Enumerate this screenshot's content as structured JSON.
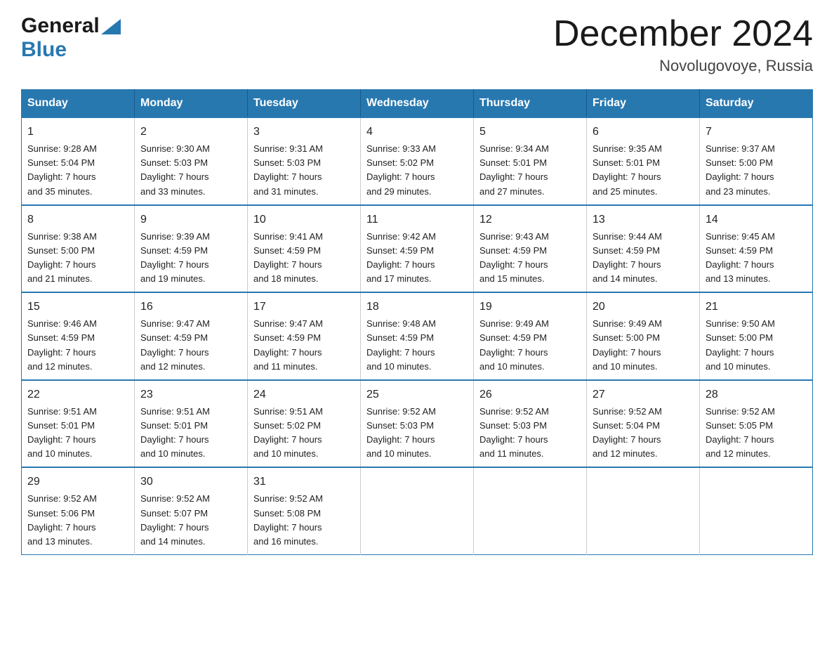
{
  "header": {
    "logo_general": "General",
    "logo_blue": "Blue",
    "month_title": "December 2024",
    "location": "Novolugovoye, Russia"
  },
  "days_of_week": [
    "Sunday",
    "Monday",
    "Tuesday",
    "Wednesday",
    "Thursday",
    "Friday",
    "Saturday"
  ],
  "weeks": [
    [
      {
        "day": "1",
        "info": "Sunrise: 9:28 AM\nSunset: 5:04 PM\nDaylight: 7 hours\nand 35 minutes."
      },
      {
        "day": "2",
        "info": "Sunrise: 9:30 AM\nSunset: 5:03 PM\nDaylight: 7 hours\nand 33 minutes."
      },
      {
        "day": "3",
        "info": "Sunrise: 9:31 AM\nSunset: 5:03 PM\nDaylight: 7 hours\nand 31 minutes."
      },
      {
        "day": "4",
        "info": "Sunrise: 9:33 AM\nSunset: 5:02 PM\nDaylight: 7 hours\nand 29 minutes."
      },
      {
        "day": "5",
        "info": "Sunrise: 9:34 AM\nSunset: 5:01 PM\nDaylight: 7 hours\nand 27 minutes."
      },
      {
        "day": "6",
        "info": "Sunrise: 9:35 AM\nSunset: 5:01 PM\nDaylight: 7 hours\nand 25 minutes."
      },
      {
        "day": "7",
        "info": "Sunrise: 9:37 AM\nSunset: 5:00 PM\nDaylight: 7 hours\nand 23 minutes."
      }
    ],
    [
      {
        "day": "8",
        "info": "Sunrise: 9:38 AM\nSunset: 5:00 PM\nDaylight: 7 hours\nand 21 minutes."
      },
      {
        "day": "9",
        "info": "Sunrise: 9:39 AM\nSunset: 4:59 PM\nDaylight: 7 hours\nand 19 minutes."
      },
      {
        "day": "10",
        "info": "Sunrise: 9:41 AM\nSunset: 4:59 PM\nDaylight: 7 hours\nand 18 minutes."
      },
      {
        "day": "11",
        "info": "Sunrise: 9:42 AM\nSunset: 4:59 PM\nDaylight: 7 hours\nand 17 minutes."
      },
      {
        "day": "12",
        "info": "Sunrise: 9:43 AM\nSunset: 4:59 PM\nDaylight: 7 hours\nand 15 minutes."
      },
      {
        "day": "13",
        "info": "Sunrise: 9:44 AM\nSunset: 4:59 PM\nDaylight: 7 hours\nand 14 minutes."
      },
      {
        "day": "14",
        "info": "Sunrise: 9:45 AM\nSunset: 4:59 PM\nDaylight: 7 hours\nand 13 minutes."
      }
    ],
    [
      {
        "day": "15",
        "info": "Sunrise: 9:46 AM\nSunset: 4:59 PM\nDaylight: 7 hours\nand 12 minutes."
      },
      {
        "day": "16",
        "info": "Sunrise: 9:47 AM\nSunset: 4:59 PM\nDaylight: 7 hours\nand 12 minutes."
      },
      {
        "day": "17",
        "info": "Sunrise: 9:47 AM\nSunset: 4:59 PM\nDaylight: 7 hours\nand 11 minutes."
      },
      {
        "day": "18",
        "info": "Sunrise: 9:48 AM\nSunset: 4:59 PM\nDaylight: 7 hours\nand 10 minutes."
      },
      {
        "day": "19",
        "info": "Sunrise: 9:49 AM\nSunset: 4:59 PM\nDaylight: 7 hours\nand 10 minutes."
      },
      {
        "day": "20",
        "info": "Sunrise: 9:49 AM\nSunset: 5:00 PM\nDaylight: 7 hours\nand 10 minutes."
      },
      {
        "day": "21",
        "info": "Sunrise: 9:50 AM\nSunset: 5:00 PM\nDaylight: 7 hours\nand 10 minutes."
      }
    ],
    [
      {
        "day": "22",
        "info": "Sunrise: 9:51 AM\nSunset: 5:01 PM\nDaylight: 7 hours\nand 10 minutes."
      },
      {
        "day": "23",
        "info": "Sunrise: 9:51 AM\nSunset: 5:01 PM\nDaylight: 7 hours\nand 10 minutes."
      },
      {
        "day": "24",
        "info": "Sunrise: 9:51 AM\nSunset: 5:02 PM\nDaylight: 7 hours\nand 10 minutes."
      },
      {
        "day": "25",
        "info": "Sunrise: 9:52 AM\nSunset: 5:03 PM\nDaylight: 7 hours\nand 10 minutes."
      },
      {
        "day": "26",
        "info": "Sunrise: 9:52 AM\nSunset: 5:03 PM\nDaylight: 7 hours\nand 11 minutes."
      },
      {
        "day": "27",
        "info": "Sunrise: 9:52 AM\nSunset: 5:04 PM\nDaylight: 7 hours\nand 12 minutes."
      },
      {
        "day": "28",
        "info": "Sunrise: 9:52 AM\nSunset: 5:05 PM\nDaylight: 7 hours\nand 12 minutes."
      }
    ],
    [
      {
        "day": "29",
        "info": "Sunrise: 9:52 AM\nSunset: 5:06 PM\nDaylight: 7 hours\nand 13 minutes."
      },
      {
        "day": "30",
        "info": "Sunrise: 9:52 AM\nSunset: 5:07 PM\nDaylight: 7 hours\nand 14 minutes."
      },
      {
        "day": "31",
        "info": "Sunrise: 9:52 AM\nSunset: 5:08 PM\nDaylight: 7 hours\nand 16 minutes."
      },
      null,
      null,
      null,
      null
    ]
  ]
}
